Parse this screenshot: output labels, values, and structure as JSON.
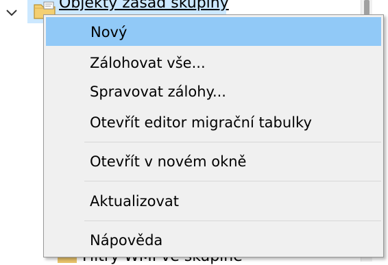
{
  "tree": {
    "node_label": "Objekty zásad skupiny",
    "bottom_label": "Filtry WMI ve skupině"
  },
  "context_menu": {
    "items": [
      {
        "label": "Nový",
        "highlighted": true
      },
      {
        "label": "Zálohovat vše..."
      },
      {
        "label": "Spravovat zálohy..."
      },
      {
        "label": "Otevřít editor migrační tabulky"
      },
      {
        "label": "Otevřít v novém okně"
      },
      {
        "label": "Aktualizovat"
      },
      {
        "label": "Nápověda"
      }
    ]
  },
  "colors": {
    "menu_background": "#f0f0f0",
    "highlight": "#91c9f7",
    "tree_selection": "#cce8ff"
  },
  "icons": [
    "chevron-down-icon",
    "folder-icon"
  ]
}
